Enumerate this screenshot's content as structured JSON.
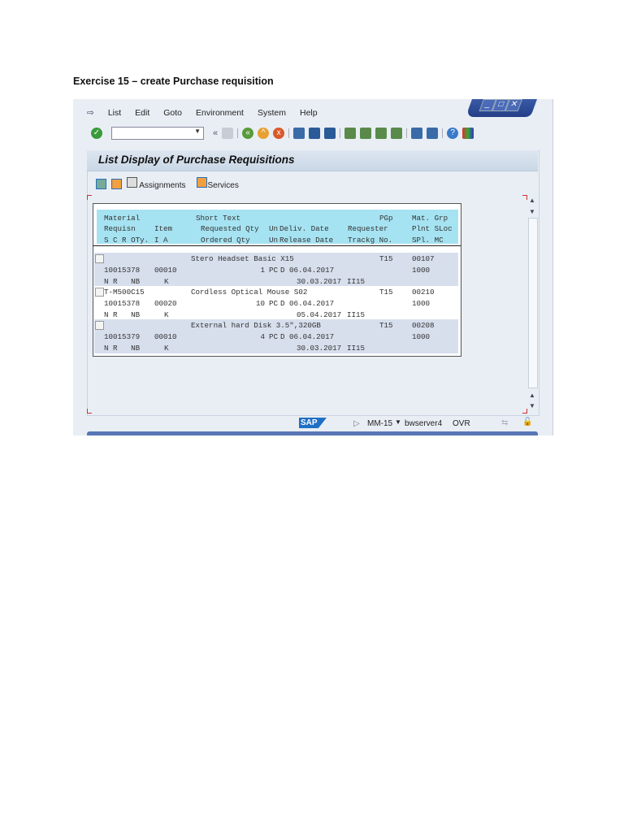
{
  "heading": "Exercise 15 – create Purchase requisition",
  "window_controls": {
    "minimize": "_",
    "maximize": "□",
    "close": "✕"
  },
  "menu": [
    {
      "u": "L",
      "rest": "ist"
    },
    {
      "u": "E",
      "rest": "dit"
    },
    {
      "u": "G",
      "rest": "oto"
    },
    {
      "u": "",
      "pre": "En",
      "uu": "v",
      "rest": "ironment"
    },
    {
      "pre": "Sy",
      "uu": "s",
      "rest": "tem"
    },
    {
      "u": "H",
      "rest": "elp"
    }
  ],
  "menu_labels": [
    "List",
    "Edit",
    "Goto",
    "Environment",
    "System",
    "Help"
  ],
  "toolbar": {
    "command_field": "",
    "back_arrows": "«"
  },
  "title": "List Display of Purchase Requisitions",
  "app_toolbar": {
    "assignments": "Assignments",
    "services": "Services"
  },
  "list": {
    "header": [
      [
        "Material",
        "",
        "Short Text",
        "",
        "",
        "",
        "PGp",
        "Mat. Grp"
      ],
      [
        "Requisn",
        "Item",
        "Requested Qty",
        "Un",
        "Deliv. Date",
        "Requester",
        "",
        "Plnt SLoc"
      ],
      [
        "S C R OTy.",
        "I A",
        "Ordered Qty",
        "Un",
        "Release Date",
        "Trackg No.",
        "",
        "SPl. MC"
      ]
    ],
    "items": [
      {
        "material": "",
        "short_text": "Stero Headset Basic X15",
        "pgp": "T15",
        "mat_grp": "00107",
        "requisn": "10015378",
        "item": "00010",
        "qty": "1",
        "un": "PC",
        "deliv": "D 06.04.2017",
        "plnt": "1000",
        "status": "N R   NB",
        "ia": "K",
        "release": "30.03.2017",
        "track": "II15"
      },
      {
        "material": "T-M500C15",
        "short_text": "Cordless Optical Mouse S02",
        "pgp": "T15",
        "mat_grp": "00210",
        "requisn": "10015378",
        "item": "00020",
        "qty": "10",
        "un": "PC",
        "deliv": "D 06.04.2017",
        "plnt": "1000",
        "status": "N R   NB",
        "ia": "K",
        "release": "05.04.2017",
        "track": "II15"
      },
      {
        "material": "",
        "short_text": "External hard Disk 3.5\",320GB",
        "pgp": "T15",
        "mat_grp": "00208",
        "requisn": "10015379",
        "item": "00010",
        "qty": "4",
        "un": "PC",
        "deliv": "D 06.04.2017",
        "plnt": "1000",
        "status": "N R   NB",
        "ia": "K",
        "release": "30.03.2017",
        "track": "II15"
      }
    ]
  },
  "status_bar": {
    "logo": "SAP",
    "transaction": "MM-15",
    "server": "bwserver4",
    "mode": "OVR"
  }
}
